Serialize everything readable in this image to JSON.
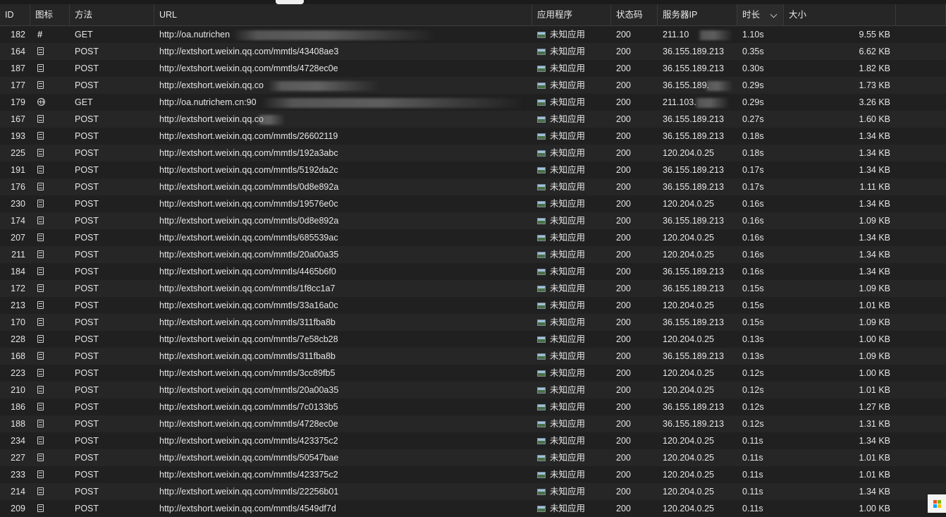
{
  "columns": {
    "id": "ID",
    "icon": "图标",
    "method": "方法",
    "url": "URL",
    "app": "应用程序",
    "status": "状态码",
    "ip": "服务器IP",
    "duration": "时长",
    "size": "大小"
  },
  "rows": [
    {
      "id": "182",
      "icon": "hash-icon",
      "method": "GET",
      "url": "http://oa.nutrichen",
      "app": "未知应用",
      "status": "200",
      "ip": "211.10",
      "duration": "1.10s",
      "size": "9.55 KB"
    },
    {
      "id": "164",
      "icon": "document-icon",
      "method": "POST",
      "url": "http://extshort.weixin.qq.com/mmtls/43408ae3",
      "app": "未知应用",
      "status": "200",
      "ip": "36.155.189.213",
      "duration": "0.35s",
      "size": "6.62 KB"
    },
    {
      "id": "187",
      "icon": "document-icon",
      "method": "POST",
      "url": "http://extshort.weixin.qq.com/mmtls/4728ec0e",
      "app": "未知应用",
      "status": "200",
      "ip": "36.155.189.213",
      "duration": "0.30s",
      "size": "1.82 KB"
    },
    {
      "id": "177",
      "icon": "document-icon",
      "method": "POST",
      "url": "http://extshort.weixin.qq.co",
      "app": "未知应用",
      "status": "200",
      "ip": "36.155.189.",
      "duration": "0.29s",
      "size": "1.73 KB"
    },
    {
      "id": "179",
      "icon": "globe-icon",
      "method": "GET",
      "url": "http://oa.nutrichem.cn:90",
      "app": "未知应用",
      "status": "200",
      "ip": "211.103.",
      "duration": "0.29s",
      "size": "3.26 KB"
    },
    {
      "id": "167",
      "icon": "document-icon",
      "method": "POST",
      "url": "http://extshort.weixin.qq.co",
      "app": "未知应用",
      "status": "200",
      "ip": "36.155.189.213",
      "duration": "0.27s",
      "size": "1.60 KB"
    },
    {
      "id": "193",
      "icon": "document-icon",
      "method": "POST",
      "url": "http://extshort.weixin.qq.com/mmtls/26602119",
      "app": "未知应用",
      "status": "200",
      "ip": "36.155.189.213",
      "duration": "0.18s",
      "size": "1.34 KB"
    },
    {
      "id": "225",
      "icon": "document-icon",
      "method": "POST",
      "url": "http://extshort.weixin.qq.com/mmtls/192a3abc",
      "app": "未知应用",
      "status": "200",
      "ip": "120.204.0.25",
      "duration": "0.18s",
      "size": "1.34 KB"
    },
    {
      "id": "191",
      "icon": "document-icon",
      "method": "POST",
      "url": "http://extshort.weixin.qq.com/mmtls/5192da2c",
      "app": "未知应用",
      "status": "200",
      "ip": "36.155.189.213",
      "duration": "0.17s",
      "size": "1.34 KB"
    },
    {
      "id": "176",
      "icon": "document-icon",
      "method": "POST",
      "url": "http://extshort.weixin.qq.com/mmtls/0d8e892a",
      "app": "未知应用",
      "status": "200",
      "ip": "36.155.189.213",
      "duration": "0.17s",
      "size": "1.11 KB"
    },
    {
      "id": "230",
      "icon": "document-icon",
      "method": "POST",
      "url": "http://extshort.weixin.qq.com/mmtls/19576e0c",
      "app": "未知应用",
      "status": "200",
      "ip": "120.204.0.25",
      "duration": "0.16s",
      "size": "1.34 KB"
    },
    {
      "id": "174",
      "icon": "document-icon",
      "method": "POST",
      "url": "http://extshort.weixin.qq.com/mmtls/0d8e892a",
      "app": "未知应用",
      "status": "200",
      "ip": "36.155.189.213",
      "duration": "0.16s",
      "size": "1.09 KB"
    },
    {
      "id": "207",
      "icon": "document-icon",
      "method": "POST",
      "url": "http://extshort.weixin.qq.com/mmtls/685539ac",
      "app": "未知应用",
      "status": "200",
      "ip": "120.204.0.25",
      "duration": "0.16s",
      "size": "1.34 KB"
    },
    {
      "id": "211",
      "icon": "document-icon",
      "method": "POST",
      "url": "http://extshort.weixin.qq.com/mmtls/20a00a35",
      "app": "未知应用",
      "status": "200",
      "ip": "120.204.0.25",
      "duration": "0.16s",
      "size": "1.34 KB"
    },
    {
      "id": "184",
      "icon": "document-icon",
      "method": "POST",
      "url": "http://extshort.weixin.qq.com/mmtls/4465b6f0",
      "app": "未知应用",
      "status": "200",
      "ip": "36.155.189.213",
      "duration": "0.16s",
      "size": "1.34 KB"
    },
    {
      "id": "172",
      "icon": "document-icon",
      "method": "POST",
      "url": "http://extshort.weixin.qq.com/mmtls/1f8cc1a7",
      "app": "未知应用",
      "status": "200",
      "ip": "36.155.189.213",
      "duration": "0.15s",
      "size": "1.09 KB"
    },
    {
      "id": "213",
      "icon": "document-icon",
      "method": "POST",
      "url": "http://extshort.weixin.qq.com/mmtls/33a16a0c",
      "app": "未知应用",
      "status": "200",
      "ip": "120.204.0.25",
      "duration": "0.15s",
      "size": "1.01 KB"
    },
    {
      "id": "170",
      "icon": "document-icon",
      "method": "POST",
      "url": "http://extshort.weixin.qq.com/mmtls/311fba8b",
      "app": "未知应用",
      "status": "200",
      "ip": "36.155.189.213",
      "duration": "0.15s",
      "size": "1.09 KB"
    },
    {
      "id": "228",
      "icon": "document-icon",
      "method": "POST",
      "url": "http://extshort.weixin.qq.com/mmtls/7e58cb28",
      "app": "未知应用",
      "status": "200",
      "ip": "120.204.0.25",
      "duration": "0.13s",
      "size": "1.00 KB"
    },
    {
      "id": "168",
      "icon": "document-icon",
      "method": "POST",
      "url": "http://extshort.weixin.qq.com/mmtls/311fba8b",
      "app": "未知应用",
      "status": "200",
      "ip": "36.155.189.213",
      "duration": "0.13s",
      "size": "1.09 KB"
    },
    {
      "id": "223",
      "icon": "document-icon",
      "method": "POST",
      "url": "http://extshort.weixin.qq.com/mmtls/3cc89fb5",
      "app": "未知应用",
      "status": "200",
      "ip": "120.204.0.25",
      "duration": "0.12s",
      "size": "1.00 KB"
    },
    {
      "id": "210",
      "icon": "document-icon",
      "method": "POST",
      "url": "http://extshort.weixin.qq.com/mmtls/20a00a35",
      "app": "未知应用",
      "status": "200",
      "ip": "120.204.0.25",
      "duration": "0.12s",
      "size": "1.01 KB"
    },
    {
      "id": "186",
      "icon": "document-icon",
      "method": "POST",
      "url": "http://extshort.weixin.qq.com/mmtls/7c0133b5",
      "app": "未知应用",
      "status": "200",
      "ip": "36.155.189.213",
      "duration": "0.12s",
      "size": "1.27 KB"
    },
    {
      "id": "188",
      "icon": "document-icon",
      "method": "POST",
      "url": "http://extshort.weixin.qq.com/mmtls/4728ec0e",
      "app": "未知应用",
      "status": "200",
      "ip": "36.155.189.213",
      "duration": "0.12s",
      "size": "1.31 KB"
    },
    {
      "id": "234",
      "icon": "document-icon",
      "method": "POST",
      "url": "http://extshort.weixin.qq.com/mmtls/423375c2",
      "app": "未知应用",
      "status": "200",
      "ip": "120.204.0.25",
      "duration": "0.11s",
      "size": "1.34 KB"
    },
    {
      "id": "227",
      "icon": "document-icon",
      "method": "POST",
      "url": "http://extshort.weixin.qq.com/mmtls/50547bae",
      "app": "未知应用",
      "status": "200",
      "ip": "120.204.0.25",
      "duration": "0.11s",
      "size": "1.01 KB"
    },
    {
      "id": "233",
      "icon": "document-icon",
      "method": "POST",
      "url": "http://extshort.weixin.qq.com/mmtls/423375c2",
      "app": "未知应用",
      "status": "200",
      "ip": "120.204.0.25",
      "duration": "0.11s",
      "size": "1.01 KB"
    },
    {
      "id": "214",
      "icon": "document-icon",
      "method": "POST",
      "url": "http://extshort.weixin.qq.com/mmtls/22256b01",
      "app": "未知应用",
      "status": "200",
      "ip": "120.204.0.25",
      "duration": "0.11s",
      "size": "1.34 KB"
    },
    {
      "id": "209",
      "icon": "document-icon",
      "method": "POST",
      "url": "http://extshort.weixin.qq.com/mmtls/4549df7d",
      "app": "未知应用",
      "status": "200",
      "ip": "120.204.0.25",
      "duration": "0.11s",
      "size": "1.00 KB"
    }
  ],
  "colors": {
    "background": "#202020",
    "row_alt": "#262626",
    "text": "#e6e6e6",
    "header": "#262626"
  }
}
